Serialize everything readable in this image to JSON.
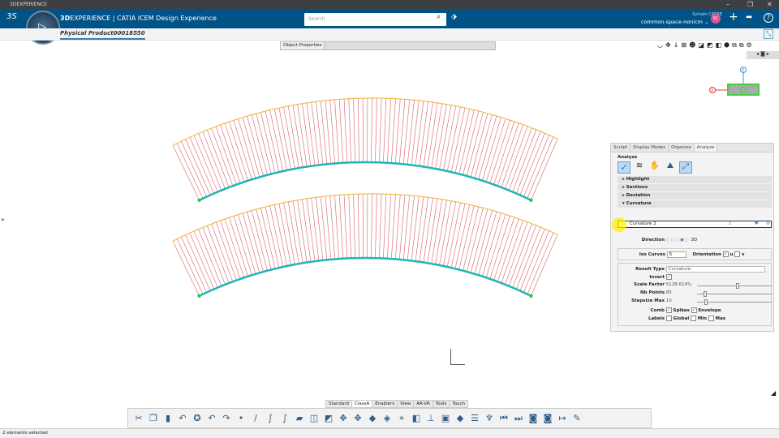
{
  "window": {
    "title": "3DEXPERIENCE",
    "controls": [
      "–",
      "❐",
      "✕"
    ]
  },
  "header": {
    "brand_bold": "3D",
    "brand_rest": "EXPERIENCE | CATIA ICEM Design Experience",
    "search_placeholder": "Search",
    "user_name": "Sylvain CARRE",
    "space": "common-space-nonicm",
    "avatar_initials": "SC"
  },
  "tabs": {
    "active": "Physical Product00018550",
    "add": "+"
  },
  "object_properties": {
    "title": "Object Properties"
  },
  "panel": {
    "tabs": [
      "Sculpt",
      "Display Modes",
      "Organize",
      "Analyze"
    ],
    "analyze_label": "Analyze",
    "sections": [
      "Highlight",
      "Sections",
      "Deviation",
      "Curvature"
    ],
    "curvature_item": "Curvature 2",
    "curvature_count": "2",
    "direction_label": "Direction",
    "direction_3d": "3D",
    "iso_label": "Iso Curves",
    "iso_value": "5",
    "orientation_label": "Orientation",
    "orient_u": "u",
    "orient_v": "v",
    "result_type_label": "Result Type",
    "result_type": "Curvature",
    "invert_label": "Invert",
    "scale_label": "Scale Factor",
    "scale_value": "5128.614%",
    "nb_points_label": "Nb Points",
    "nb_points": "85",
    "stepsize_label": "Stepsize Max",
    "stepsize": "10",
    "comb_label": "Comb",
    "spikes": "Spikes",
    "envelope": "Envelope",
    "labels_label": "Labels",
    "global": "Global",
    "min": "Min",
    "max": "Max"
  },
  "toolbar": {
    "tabs": [
      "Standard",
      "ClassA",
      "Enablers",
      "View",
      "AR-VR",
      "Tools",
      "Touch"
    ],
    "active_tab": "ClassA"
  },
  "status": {
    "text": "2 elements selected"
  },
  "colors": {
    "header": "#005386",
    "comb": "#d9606a",
    "envelope": "#f0b030",
    "curve": "#1fb5b5",
    "point": "#22cc44"
  }
}
